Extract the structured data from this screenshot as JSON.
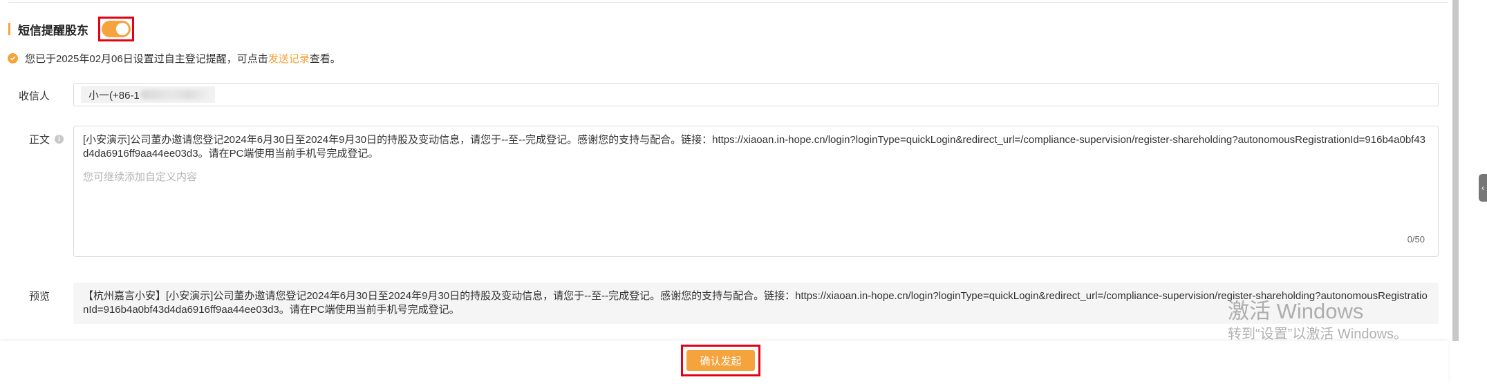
{
  "section": {
    "title": "短信提醒股东",
    "toggle_on": true
  },
  "notice": {
    "text_before": "您已于2025年02月06日设置过自主登记提醒，可点击",
    "link_text": "发送记录",
    "text_after": "查看。"
  },
  "recipient": {
    "label": "收信人",
    "tag_prefix": "小一(+86-1"
  },
  "body": {
    "label": "正文",
    "content": "[小安演示]公司董办邀请您登记2024年6月30日至2024年9月30日的持股及变动信息，请您于--至--完成登记。感谢您的支持与配合。链接：https://xiaoan.in-hope.cn/login?loginType=quickLogin&redirect_url=/compliance-supervision/register-shareholding?autonomousRegistrationId=916b4a0bf43d4da6916ff9aa44ee03d3。请在PC端使用当前手机号完成登记。",
    "placeholder": "您可继续添加自定义内容",
    "counter": "0/50"
  },
  "preview": {
    "label": "预览",
    "content": "【杭州嘉言小安】[小安演示]公司董办邀请您登记2024年6月30日至2024年9月30日的持股及变动信息，请您于--至--完成登记。感谢您的支持与配合。链接：https://xiaoan.in-hope.cn/login?loginType=quickLogin&redirect_url=/compliance-supervision/register-shareholding?autonomousRegistrationId=916b4a0bf43d4da6916ff9aa44ee03d3。请在PC端使用当前手机号完成登记。"
  },
  "footer": {
    "confirm_label": "确认发起"
  },
  "watermark": {
    "title": "激活 Windows",
    "subtitle": "转到“设置”以激活 Windows。"
  },
  "colors": {
    "accent": "#f5a33c",
    "highlight_border": "#e60012"
  },
  "icons": {
    "notice": "check-circle-icon",
    "body_info": "info-icon",
    "side_handle": "chevron-left-icon"
  }
}
